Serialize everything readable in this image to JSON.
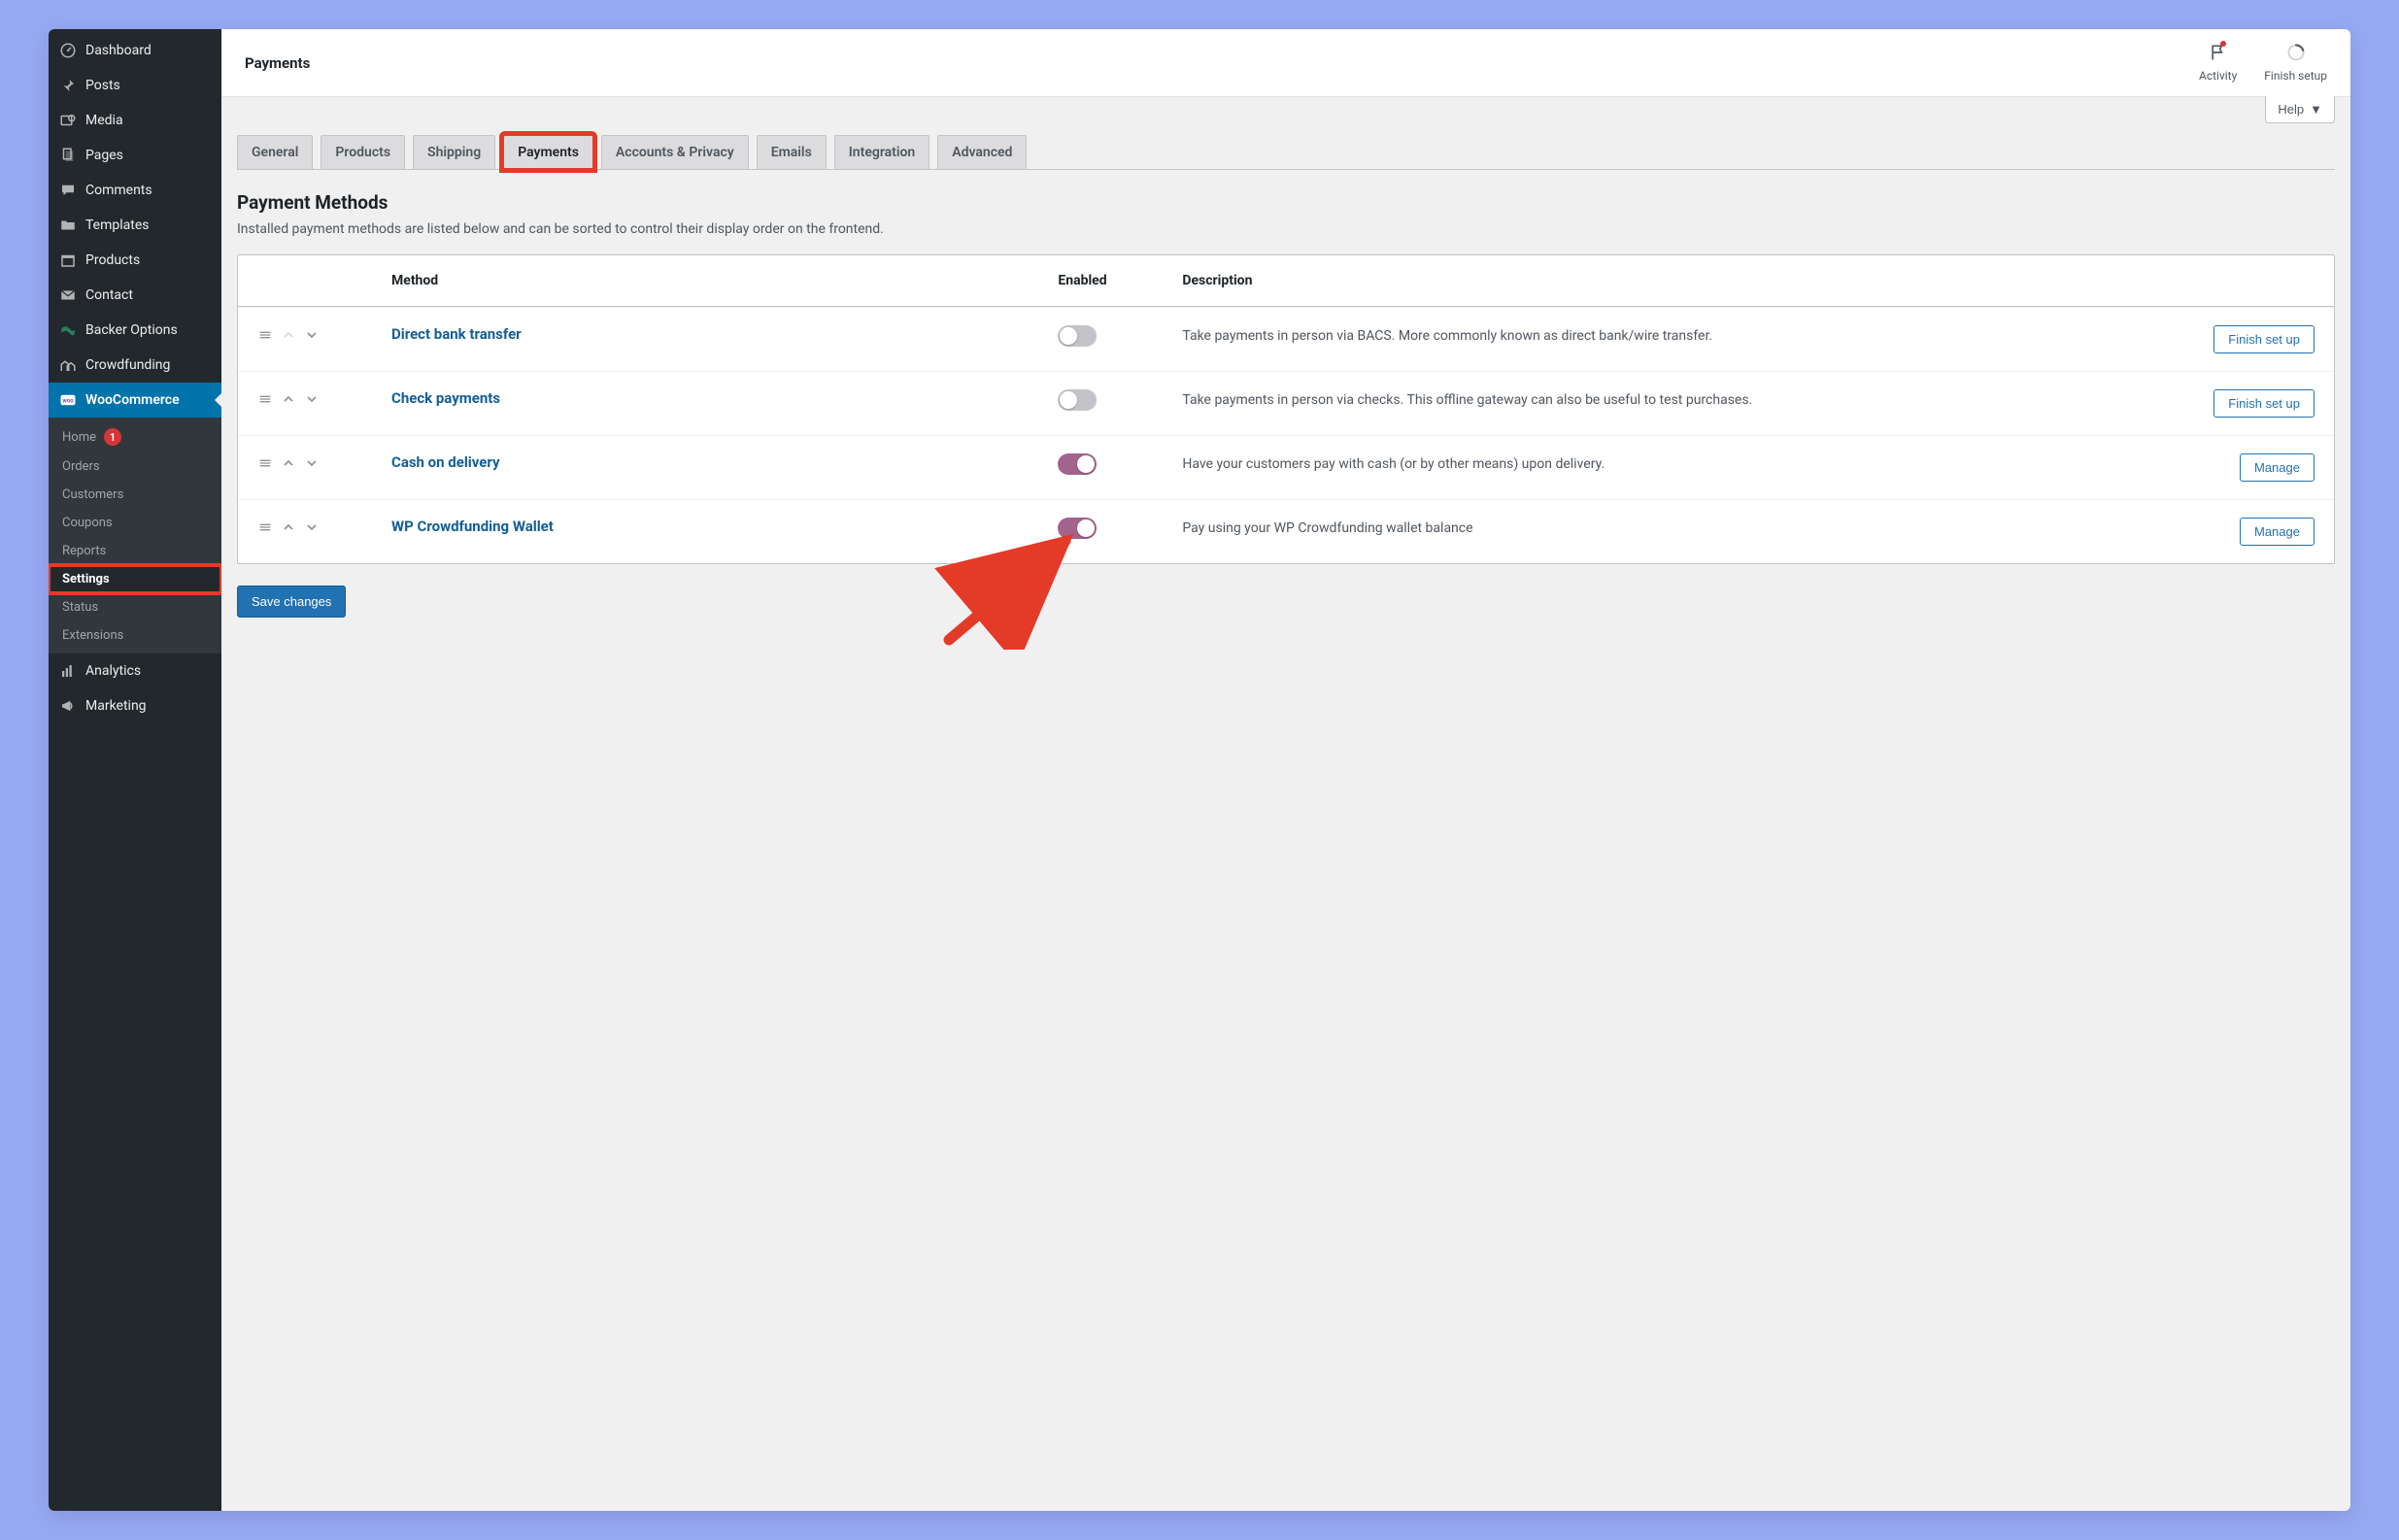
{
  "sidebar": {
    "items": [
      {
        "label": "Dashboard",
        "icon": "dashboard"
      },
      {
        "label": "Posts",
        "icon": "pin"
      },
      {
        "label": "Media",
        "icon": "media"
      },
      {
        "label": "Pages",
        "icon": "pages"
      },
      {
        "label": "Comments",
        "icon": "comment"
      },
      {
        "label": "Templates",
        "icon": "folder"
      },
      {
        "label": "Products",
        "icon": "archive"
      },
      {
        "label": "Contact",
        "icon": "mail"
      },
      {
        "label": "Backer Options",
        "icon": "money",
        "green": true
      },
      {
        "label": "Crowdfunding",
        "icon": "houses"
      }
    ],
    "activeItem": {
      "label": "WooCommerce",
      "icon": "woo"
    },
    "submenu": [
      {
        "label": "Home",
        "badge": "1"
      },
      {
        "label": "Orders"
      },
      {
        "label": "Customers"
      },
      {
        "label": "Coupons"
      },
      {
        "label": "Reports"
      },
      {
        "label": "Settings",
        "selected": true,
        "highlight": true
      },
      {
        "label": "Status"
      },
      {
        "label": "Extensions"
      }
    ],
    "after": [
      {
        "label": "Analytics",
        "icon": "analytics"
      },
      {
        "label": "Marketing",
        "icon": "megaphone"
      }
    ]
  },
  "topbar": {
    "title": "Payments",
    "activity": "Activity",
    "finish_setup": "Finish setup"
  },
  "help_label": "Help",
  "tabs": [
    {
      "label": "General"
    },
    {
      "label": "Products"
    },
    {
      "label": "Shipping"
    },
    {
      "label": "Payments",
      "active": true,
      "highlight": true
    },
    {
      "label": "Accounts & Privacy"
    },
    {
      "label": "Emails"
    },
    {
      "label": "Integration"
    },
    {
      "label": "Advanced"
    }
  ],
  "section": {
    "title": "Payment Methods",
    "desc": "Installed payment methods are listed below and can be sorted to control their display order on the frontend."
  },
  "table": {
    "headers": {
      "method": "Method",
      "enabled": "Enabled",
      "description": "Description"
    },
    "rows": [
      {
        "method": "Direct bank transfer",
        "enabled": false,
        "desc": "Take payments in person via BACS. More commonly known as direct bank/wire transfer.",
        "action": "Finish set up",
        "up_dim": true
      },
      {
        "method": "Check payments",
        "enabled": false,
        "desc": "Take payments in person via checks. This offline gateway can also be useful to test purchases.",
        "action": "Finish set up"
      },
      {
        "method": "Cash on delivery",
        "enabled": true,
        "desc": "Have your customers pay with cash (or by other means) upon delivery.",
        "action": "Manage"
      },
      {
        "method": "WP Crowdfunding Wallet",
        "enabled": true,
        "desc": "Pay using your WP Crowdfunding wallet balance",
        "action": "Manage"
      }
    ]
  },
  "save_label": "Save changes"
}
